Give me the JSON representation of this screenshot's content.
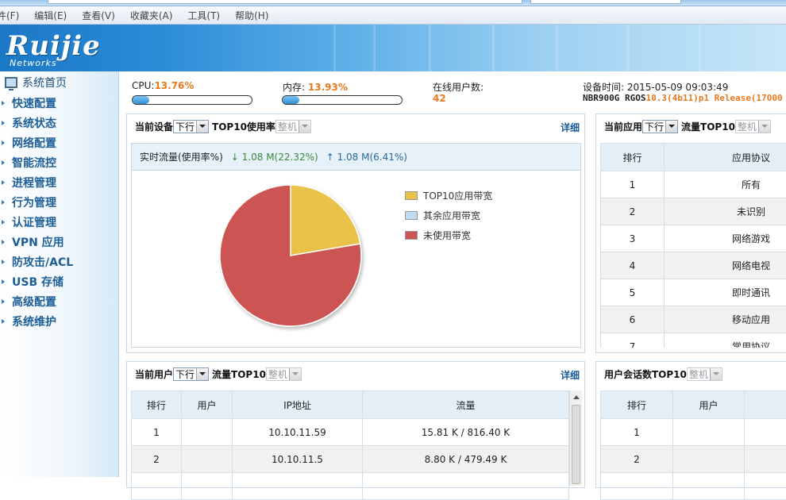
{
  "menu": [
    "件(F)",
    "编辑(E)",
    "查看(V)",
    "收藏夹(A)",
    "工具(T)",
    "帮助(H)"
  ],
  "brand": {
    "logo": "Ruijie",
    "sub": "Networks"
  },
  "sidebar": {
    "home": "系统首页",
    "items": [
      "快速配置",
      "系统状态",
      "网络配置",
      "智能流控",
      "进程管理",
      "行为管理",
      "认证管理",
      "VPN 应用",
      "防攻击/ACL",
      "USB 存储",
      "高级配置",
      "系统维护"
    ]
  },
  "stats": {
    "cpu_label": "CPU:",
    "cpu_value": "13.76%",
    "cpu_fraction": 0.1376,
    "mem_label": "内存:",
    "mem_value": "13.93%",
    "mem_fraction": 0.1393,
    "users_label": "在线用户数:",
    "users_value": "42",
    "time_label": "设备时间:",
    "time_value": "2015-05-09 09:03:49",
    "version_prefix": "NBR900G RGOS",
    "version_value": "10.3(4b11)p1 Release(17000"
  },
  "device_panel": {
    "label": "当前设备",
    "dir": "下行",
    "title": "TOP10使用率",
    "scope": "整机",
    "detail": "详细",
    "flow_label": "实时流量(使用率%)",
    "down_arrow": "↓",
    "down": "1.08 M(22.32%)",
    "up_arrow": "↑",
    "up": "1.08 M(6.41%)",
    "legend": [
      {
        "label": "TOP10应用带宽",
        "color": "#e9c24a"
      },
      {
        "label": "其余应用带宽",
        "color": "#bfdcf3"
      },
      {
        "label": "未使用带宽",
        "color": "#cc5452"
      }
    ]
  },
  "chart_data": {
    "type": "pie",
    "labels": [
      "TOP10应用带宽",
      "其余应用带宽",
      "未使用带宽"
    ],
    "values": [
      22.32,
      0,
      77.68
    ],
    "colors": [
      "#e9c24a",
      "#bfdcf3",
      "#cc5452"
    ]
  },
  "app_panel": {
    "label": "当前应用",
    "dir": "下行",
    "title": "流量TOP10",
    "scope": "整机",
    "headers": [
      "排行",
      "应用协议"
    ],
    "rows": [
      [
        "1",
        "所有"
      ],
      [
        "2",
        "未识别"
      ],
      [
        "3",
        "网络游戏"
      ],
      [
        "4",
        "网络电视"
      ],
      [
        "5",
        "即时通讯"
      ],
      [
        "6",
        "移动应用"
      ],
      [
        "7",
        "常用协议"
      ]
    ]
  },
  "user_panel": {
    "label": "当前用户",
    "dir": "下行",
    "title": "流量TOP10",
    "scope": "整机",
    "detail": "详细",
    "headers": [
      "排行",
      "用户",
      "IP地址",
      "流量"
    ],
    "rows": [
      [
        "1",
        "",
        "10.10.11.59",
        "15.81 K / 816.40 K"
      ],
      [
        "2",
        "",
        "10.10.11.5",
        "8.80 K / 479.49 K"
      ]
    ]
  },
  "session_panel": {
    "title": "用户会话数TOP10",
    "scope": "整机",
    "headers": [
      "排行",
      "用户"
    ],
    "rows": [
      [
        "1",
        ""
      ],
      [
        "2",
        ""
      ]
    ]
  }
}
